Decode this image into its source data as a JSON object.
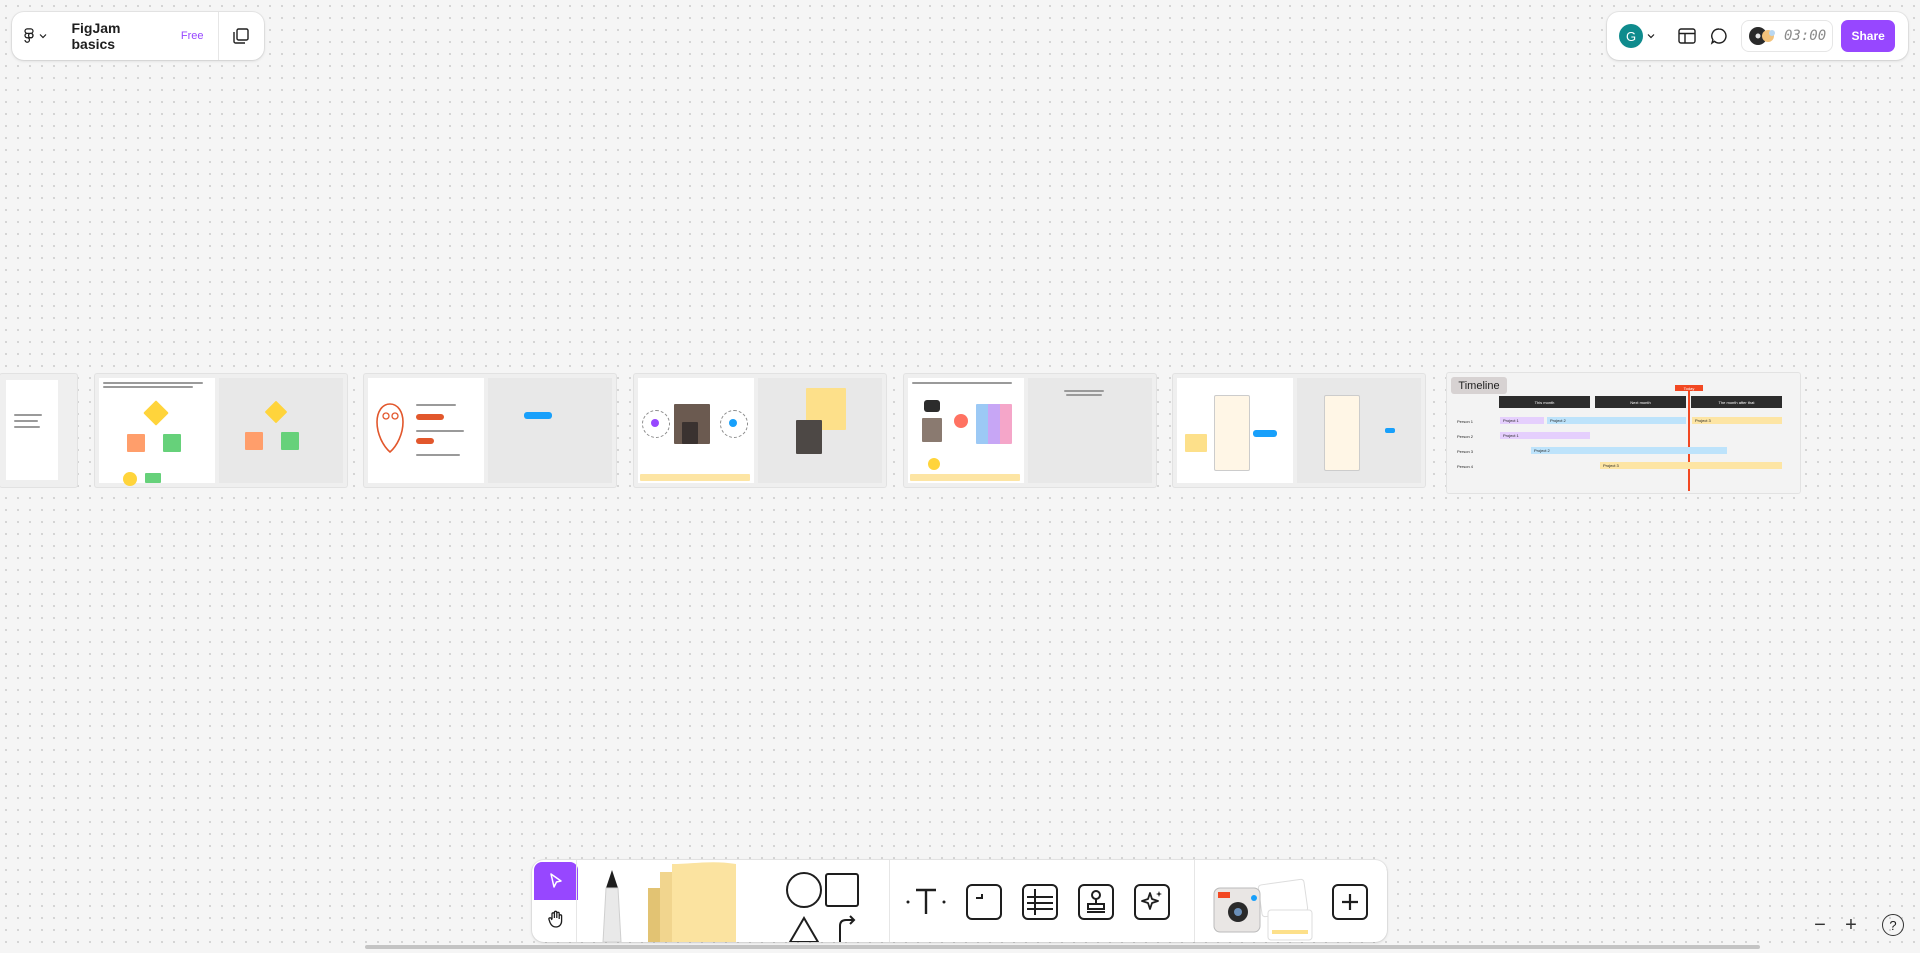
{
  "header": {
    "file_title": "FigJam basics",
    "plan_badge": "Free",
    "main_menu_icon": "figma-logo-icon",
    "pages_icon": "pages-icon"
  },
  "top_right": {
    "avatar_initial": "G",
    "avatar_color": "#0f8b8d",
    "timer_text": "03:00",
    "share_label": "Share",
    "accent": "#9747ff"
  },
  "timeline": {
    "title": "Timeline",
    "columns": [
      "This month",
      "Next month",
      "The month after that"
    ],
    "rows": [
      "Person 1",
      "Person 2",
      "Person 3",
      "Person 4"
    ],
    "bars": [
      {
        "label": "Project 1",
        "color": "#e5cffd"
      },
      {
        "label": "Project 2",
        "color": "#bde3fb"
      },
      {
        "label": "Project 3",
        "color": "#fde5a4"
      },
      {
        "label": "Project 1",
        "color": "#e5cffd"
      },
      {
        "label": "Project 2",
        "color": "#bde3fb"
      },
      {
        "label": "Project 3",
        "color": "#fde5a4"
      }
    ],
    "today_marker": "Today"
  },
  "toolbar": {
    "tools": [
      {
        "name": "select-tool",
        "icon": "cursor-arrow-icon"
      },
      {
        "name": "hand-tool",
        "icon": "hand-icon"
      },
      {
        "name": "marker-tool",
        "icon": "marker-icon"
      },
      {
        "name": "sticky-note-tool",
        "icon": "sticky-note-icon"
      },
      {
        "name": "shape-tool",
        "icon": "shapes-icon"
      },
      {
        "name": "text-tool",
        "icon": "text-icon"
      },
      {
        "name": "section-tool",
        "icon": "section-icon"
      },
      {
        "name": "table-tool",
        "icon": "table-icon"
      },
      {
        "name": "stamp-tool",
        "icon": "stamp-icon"
      },
      {
        "name": "ai-tool",
        "icon": "sparkle-icon"
      },
      {
        "name": "widgets-tool",
        "icon": "stickers-icon"
      },
      {
        "name": "more-tool",
        "icon": "plus-icon"
      }
    ]
  },
  "zoom": {
    "out_label": "−",
    "in_label": "+",
    "help_label": "?"
  }
}
